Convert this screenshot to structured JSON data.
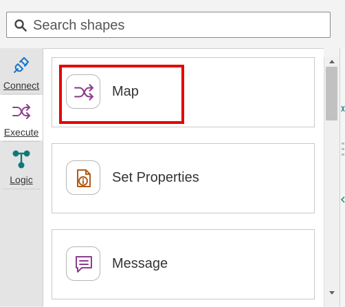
{
  "search": {
    "placeholder": "Search shapes"
  },
  "sidebar": {
    "tabs": [
      {
        "label": "Connect",
        "icon": "plug-icon",
        "color": "#1a73c8"
      },
      {
        "label": "Execute",
        "icon": "shuffle-icon",
        "color": "#8e3c8e",
        "active": true
      },
      {
        "label": "Logic",
        "icon": "branch-icon",
        "color": "#0f7a7a"
      }
    ]
  },
  "shapes": [
    {
      "label": "Map",
      "icon": "shuffle-icon",
      "color": "#8e3c8e"
    },
    {
      "label": "Set Properties",
      "icon": "document-info-icon",
      "color": "#b25a14"
    },
    {
      "label": "Message",
      "icon": "message-icon",
      "color": "#8e3c8e"
    }
  ],
  "colors": {
    "highlight": "#e60000",
    "accent_teal": "#0f7a7a"
  }
}
